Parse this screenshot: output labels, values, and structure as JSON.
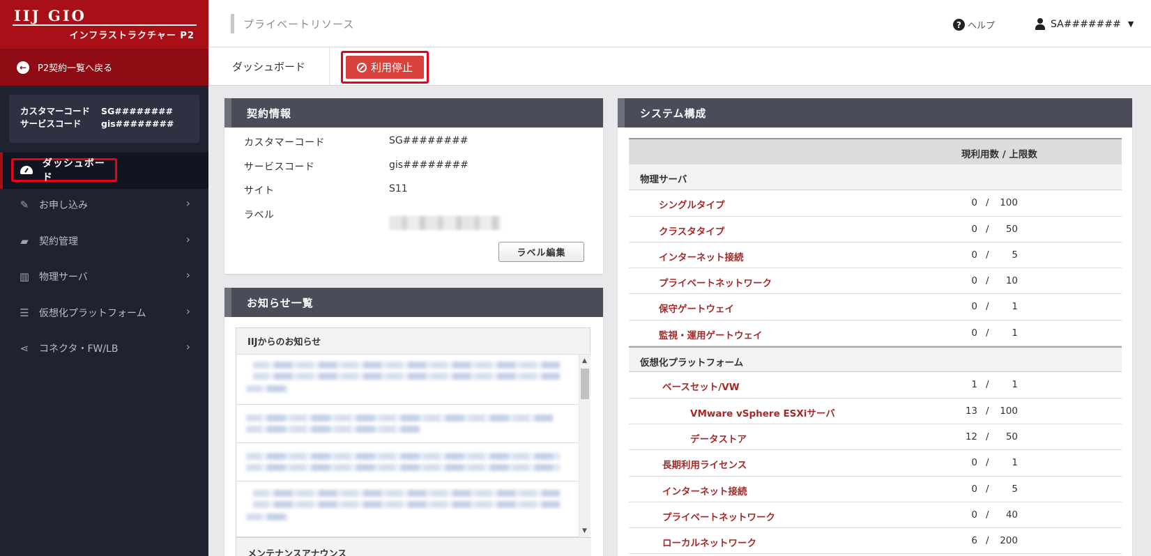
{
  "brand": {
    "logo": "IIJ GIO",
    "subtitle": "インフラストラクチャー P2",
    "color": "#a80f17"
  },
  "sidebar": {
    "back_label": "P2契約一覧へ戻る",
    "customer": {
      "customer_code_label": "カスタマーコード",
      "customer_code": "SG########",
      "service_code_label": "サービスコード",
      "service_code": "gis########"
    },
    "active_item": {
      "label": "ダッシュボード",
      "icon": "dashboard-icon"
    },
    "items": [
      {
        "label": "お申し込み",
        "icon": "edit-icon"
      },
      {
        "label": "契約管理",
        "icon": "truck-icon"
      },
      {
        "label": "物理サーバ",
        "icon": "building-icon"
      },
      {
        "label": "仮想化プラットフォーム",
        "icon": "server-stack-icon"
      },
      {
        "label": "コネクタ・FW/LB",
        "icon": "share-icon"
      }
    ]
  },
  "header": {
    "breadcrumb": "プライベートリソース",
    "help_label": "ヘルプ",
    "user_label": "SA#######"
  },
  "tabs": {
    "dashboard_label": "ダッシュボード",
    "stop_label": "利用停止"
  },
  "contract": {
    "title": "契約情報",
    "rows": [
      {
        "label": "カスタマーコード",
        "value": "SG########"
      },
      {
        "label": "サービスコード",
        "value": "gis########"
      },
      {
        "label": "サイト",
        "value": "S11"
      },
      {
        "label": "ラベル",
        "value": ""
      }
    ],
    "edit_label": "ラベル編集"
  },
  "news": {
    "title": "お知らせ一覧",
    "source_iij": "IIJからのお知らせ",
    "source_maintenance": "メンテナンスアナウンス"
  },
  "system": {
    "title": "システム構成",
    "column_header": "現利用数 / 上限数",
    "groups": [
      {
        "name": "物理サーバ",
        "rows": [
          {
            "name": "シングルタイプ",
            "current": "0",
            "limit": "100"
          },
          {
            "name": "クラスタタイプ",
            "current": "0",
            "limit": "50"
          },
          {
            "name": "インターネット接続",
            "current": "0",
            "limit": "5"
          },
          {
            "name": "プライベートネットワーク",
            "current": "0",
            "limit": "10"
          },
          {
            "name": "保守ゲートウェイ",
            "current": "0",
            "limit": "1"
          },
          {
            "name": "監視・運用ゲートウェイ",
            "current": "0",
            "limit": "1"
          }
        ]
      },
      {
        "name": "仮想化プラットフォーム",
        "rows": [
          {
            "name": "ベースセット/VW",
            "current": "1",
            "limit": "1"
          },
          {
            "name": "VMware vSphere ESXiサーバ",
            "current": "13",
            "limit": "100"
          },
          {
            "name": "データストア",
            "current": "12",
            "limit": "50"
          },
          {
            "name": "長期利用ライセンス",
            "current": "0",
            "limit": "1"
          },
          {
            "name": "インターネット接続",
            "current": "0",
            "limit": "5"
          },
          {
            "name": "プライベートネットワーク",
            "current": "0",
            "limit": "40"
          },
          {
            "name": "ローカルネットワーク",
            "current": "6",
            "limit": "200"
          }
        ]
      }
    ]
  }
}
